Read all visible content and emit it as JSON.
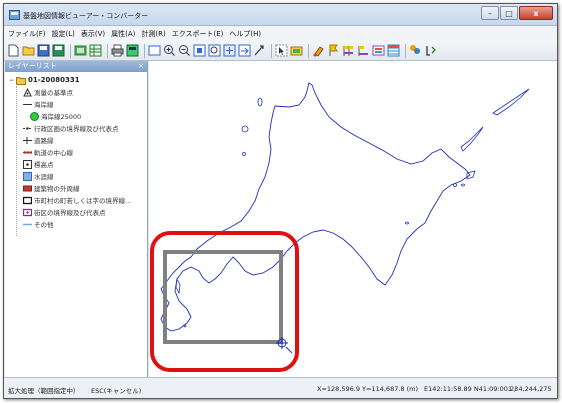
{
  "window": {
    "title": "基盤地図情報ビューアー・コンバーター",
    "minimize": "–",
    "maximize": "□",
    "close": "x"
  },
  "menu": [
    "ファイル(F)",
    "設定(L)",
    "表示(V)",
    "属性(A)",
    "計測(R)",
    "エクスポート(E)",
    "ヘルプ(H)"
  ],
  "layers": {
    "header": "レイヤーリスト",
    "close": "×",
    "root": "01-20080331",
    "items": [
      {
        "label": "測量の基準点",
        "icon": "survey-point-icon",
        "indent": 1
      },
      {
        "label": "海岸線",
        "icon": "coastline-icon",
        "indent": 1
      },
      {
        "label": "海岸線25000",
        "icon": "coastline-25000-icon",
        "indent": 2
      },
      {
        "label": "行政区画の境界線及び代表点",
        "icon": "admin-boundary-icon",
        "indent": 1
      },
      {
        "label": "道路縁",
        "icon": "road-edge-icon",
        "indent": 1
      },
      {
        "label": "軌道の中心線",
        "icon": "railway-icon",
        "indent": 1
      },
      {
        "label": "標高点",
        "icon": "elevation-point-icon",
        "indent": 1
      },
      {
        "label": "水涯線",
        "icon": "waterline-icon",
        "indent": 1
      },
      {
        "label": "建築物の外周線",
        "icon": "building-icon",
        "indent": 1
      },
      {
        "label": "市町村の町若しくは字の境界線...",
        "icon": "town-boundary-icon",
        "indent": 1
      },
      {
        "label": "街区の境界線及び代表点",
        "icon": "block-boundary-icon",
        "indent": 1
      },
      {
        "label": "その他",
        "icon": "other-icon",
        "indent": 1
      }
    ]
  },
  "status": {
    "mode": "拡大処理（範囲指定中）",
    "esc": "ESC(キャンセル)",
    "xy": "X=128,596.9 Y=114,687.8 (m)",
    "latlon": "E142:11:58.89 N41:09:00.23",
    "scale": "1 / 4,244,275"
  },
  "colors": {
    "coastline": "#1f2fb8",
    "selection_box": "#808080",
    "annotation_circle": "#e01010"
  }
}
